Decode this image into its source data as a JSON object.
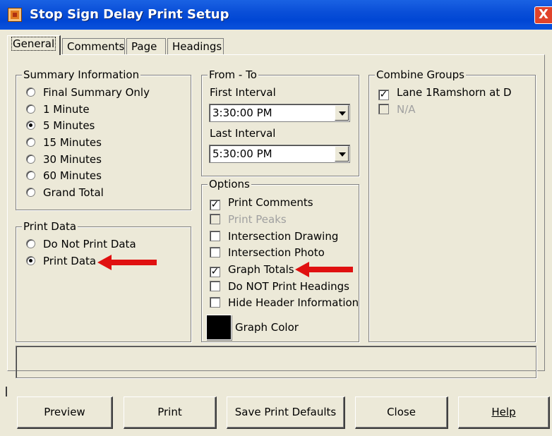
{
  "window": {
    "title": "Stop Sign Delay Print Setup",
    "close_glyph": "X"
  },
  "tabs": [
    "General",
    "Comments",
    "Page",
    "Headings"
  ],
  "summary": {
    "legend": "Summary Information",
    "options": [
      "Final Summary Only",
      "1 Minute",
      "5 Minutes",
      "15 Minutes",
      "30 Minutes",
      "60 Minutes",
      "Grand Total"
    ],
    "selected_index": 2
  },
  "print_data": {
    "legend": "Print Data",
    "options": [
      "Do Not Print Data",
      "Print Data"
    ],
    "selected_index": 1
  },
  "from_to": {
    "legend": "From - To",
    "first_label": "First Interval",
    "first_value": "3:30:00 PM",
    "last_label": "Last Interval",
    "last_value": "5:30:00 PM"
  },
  "options": {
    "legend": "Options",
    "items": [
      {
        "label": "Print Comments",
        "checked": true,
        "disabled": false
      },
      {
        "label": "Print Peaks",
        "checked": false,
        "disabled": true
      },
      {
        "label": "Intersection Drawing",
        "checked": false,
        "disabled": false
      },
      {
        "label": "Intersection Photo",
        "checked": false,
        "disabled": false
      },
      {
        "label": "Graph Totals",
        "checked": true,
        "disabled": false
      },
      {
        "label": "Do NOT Print Headings",
        "checked": false,
        "disabled": false
      },
      {
        "label": "Hide Header Information",
        "checked": false,
        "disabled": false
      }
    ],
    "graph_color_label": "Graph Color",
    "graph_color": "#000000"
  },
  "combine_groups": {
    "legend": "Combine Groups",
    "items": [
      {
        "label": "Lane 1Ramshorn at D",
        "checked": true,
        "disabled": false
      },
      {
        "label": "N/A",
        "checked": false,
        "disabled": true
      }
    ]
  },
  "buttons": {
    "preview": "Preview",
    "print": "Print",
    "save_defaults": "Save Print Defaults",
    "close": "Close",
    "help": "Help"
  },
  "colors": {
    "titlebar": "#0a4fd8",
    "annotation_arrow": "#e01010",
    "dialog_bg": "#ece9d8"
  }
}
